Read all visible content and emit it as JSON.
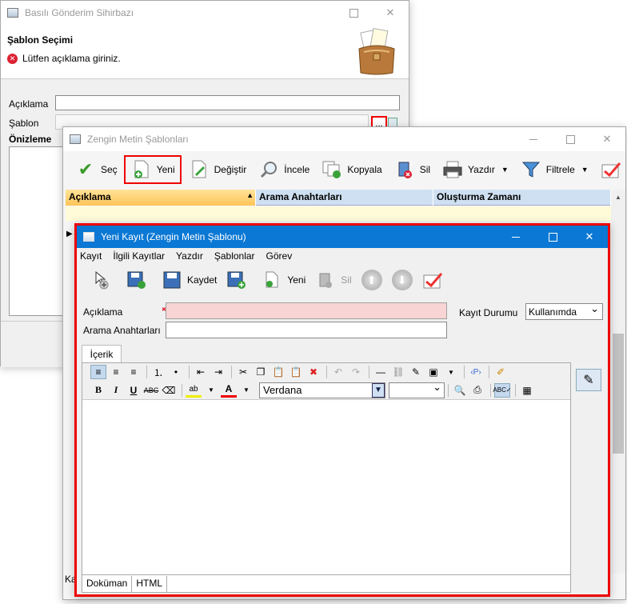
{
  "wizard": {
    "title": "Basılı Gönderim Sihirbazı",
    "section_title": "Şablon Seçimi",
    "error_message": "Lütfen açıklama giriniz.",
    "label_aciklama": "Açıklama",
    "label_sablon": "Şablon",
    "label_onizleme": "Önizleme",
    "ellipsis_button": "..."
  },
  "templates_window": {
    "title": "Zengin Metin Şablonları",
    "toolbar": [
      {
        "label": "Seç",
        "icon": "check-icon"
      },
      {
        "label": "Yeni",
        "icon": "new-doc-icon"
      },
      {
        "label": "Değiştir",
        "icon": "edit-doc-icon"
      },
      {
        "label": "İncele",
        "icon": "magnifier-icon"
      },
      {
        "label": "Kopyala",
        "icon": "copy-icon"
      },
      {
        "label": "Sil",
        "icon": "delete-icon"
      },
      {
        "label": "Yazdır",
        "icon": "printer-icon"
      },
      {
        "label": "Filtrele",
        "icon": "filter-icon"
      }
    ],
    "columns": [
      "Açıklama",
      "Arama Anahtarları",
      "Oluşturma Zamanı"
    ],
    "footer_label": "Ka"
  },
  "new_record": {
    "title": "Yeni Kayıt (Zengin Metin Şablonu)",
    "menu": [
      "Kayıt",
      "İlgili Kayıtlar",
      "Yazdır",
      "Şablonlar",
      "Görev"
    ],
    "toolbar": {
      "save_label": "Kaydet",
      "new_label": "Yeni",
      "delete_label": "Sil"
    },
    "fields": {
      "aciklama_label": "Açıklama",
      "aciklama_value": "",
      "arama_label": "Arama Anahtarları",
      "arama_value": "",
      "status_label": "Kayıt Durumu",
      "status_value": "Kullanımda"
    },
    "tab_label": "İçerik",
    "editor": {
      "font": "Verdana",
      "font_size": "",
      "tabs": [
        "Doküman",
        "HTML"
      ]
    }
  },
  "colors": {
    "highlight_border": "#ee0000",
    "titlebar_active": "#0a78d4",
    "error_field_bg": "#f9d4d4",
    "grid_header": "#cfe0f2",
    "sorted_header": "#ffc457"
  }
}
